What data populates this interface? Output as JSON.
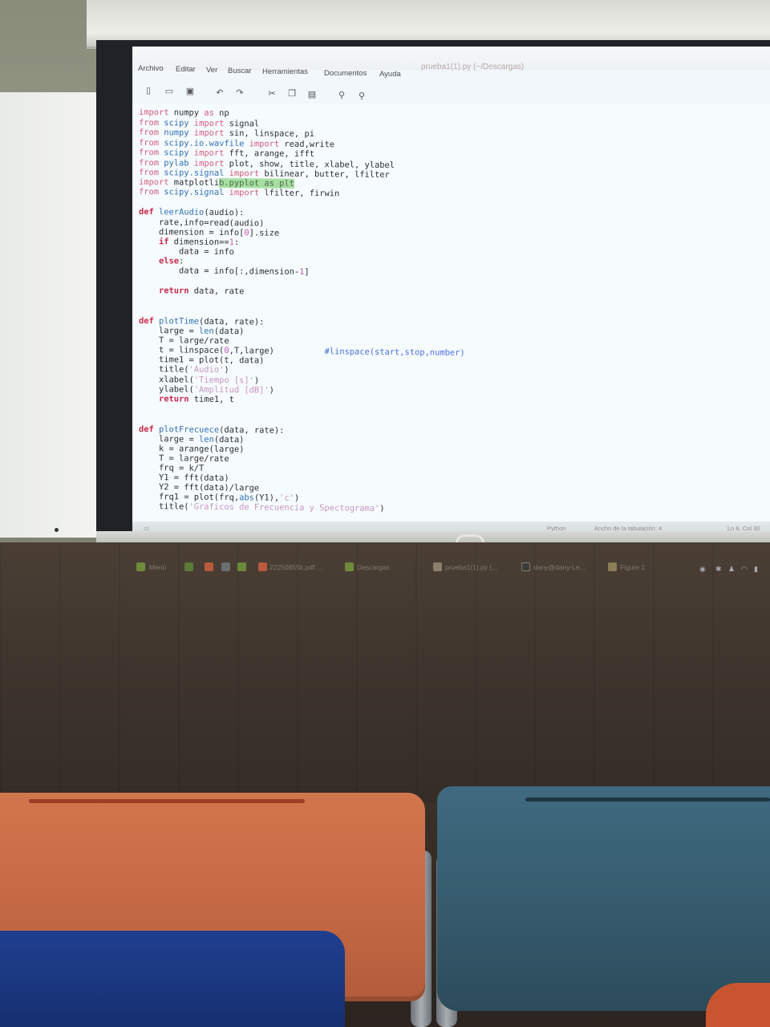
{
  "editor": {
    "window_title": "prueba1(1).py (~/Descargas)",
    "menu": [
      "Archivo",
      "Editar",
      "Ver",
      "Buscar",
      "Herramientas",
      "Documentos",
      "Ayuda"
    ],
    "toolbar_icons": [
      "new-file-icon",
      "open-file-icon",
      "save-icon",
      "undo-icon",
      "redo-icon",
      "cut-icon",
      "copy-icon",
      "paste-icon",
      "search-icon",
      "replace-icon"
    ],
    "code_lines": [
      "import numpy as np",
      "from scipy import signal",
      "from numpy import sin, linspace, pi",
      "from scipy.io.wavfile import read,write",
      "from scipy import fft, arange, ifft",
      "from pylab import plot, show, title, xlabel, ylabel",
      "from scipy.signal import bilinear, butter, lfilter",
      "import matplotlib.pyplot as plt",
      "from scipy.signal import lfilter, firwin",
      "",
      "def leerAudio(audio):",
      "    rate,info=read(audio)",
      "    dimension = info[0].size",
      "    if dimension==1:",
      "        data = info",
      "    else:",
      "        data = info[:,dimension-1]",
      "",
      "    return data, rate",
      "",
      "",
      "def plotTime(data, rate):",
      "    large = len(data)",
      "    T = large/rate",
      "    t = linspace(0,T,large)",
      "    time1 = plot(t, data)",
      "    title('Audio')",
      "    xlabel('Tiempo [s]')",
      "    ylabel('Amplitud [dB]')",
      "    return time1, t",
      "",
      "",
      "def plotFrecuece(data, rate):",
      "    large = len(data)",
      "    k = arange(large)",
      "    T = large/rate",
      "    frq = k/T",
      "    Y1 = fft(data)",
      "    Y2 = fft(data)/large",
      "    frq1 = plot(frq,abs(Y1),'c')",
      "    title('Graficos de Frecuencia y Spectograma')"
    ],
    "comment": "#linspace(start,stop,number)",
    "status": {
      "language": "Python",
      "tab_width": "Ancho de la tabulación: 4",
      "position": "Ln 8, Col 30"
    }
  },
  "taskbar": {
    "menu_label": "Menú",
    "items": [
      "22250855k.pdf ...",
      "Descargas",
      "prueba1(1).py (...",
      "dany@dany-Le...",
      "Figure 1"
    ]
  },
  "colors": {
    "keyword": "#c7284a",
    "function": "#2f6fb5",
    "string": "#c796c2",
    "number": "#c45cb7",
    "comment": "#4a6fe0",
    "highlight": "#a7dfa3"
  }
}
